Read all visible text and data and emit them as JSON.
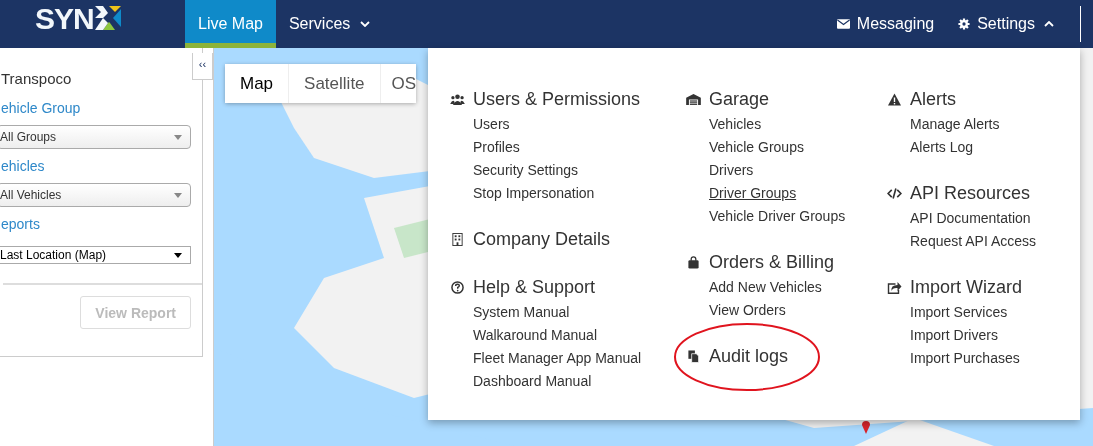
{
  "logo": {
    "text": "SYN"
  },
  "nav": [
    {
      "label": "Live Map",
      "selected": true,
      "kind": "tab"
    },
    {
      "label": "Services",
      "selected": false,
      "kind": "dropdown",
      "expanded": false
    }
  ],
  "nav_right": [
    {
      "label": "Messaging",
      "kind": "link"
    },
    {
      "label": "Settings",
      "expanded": true,
      "kind": "dropdown"
    }
  ],
  "sidebar": {
    "collapse": "‹‹",
    "company": "Transpoco",
    "fields": [
      {
        "label": "ehicle Group",
        "value": "All Groups",
        "kind": "styled"
      },
      {
        "label": "ehicles",
        "value": "All Vehicles",
        "kind": "styled"
      },
      {
        "label": "eports",
        "value": "Last Location (Map)",
        "kind": "native"
      }
    ],
    "button": {
      "label": "View Report",
      "disabled": true
    }
  },
  "map": {
    "kind": "picture",
    "map_types": [
      {
        "label": "Map",
        "selected": true
      },
      {
        "label": "Satellite",
        "selected": false
      },
      {
        "label": "OS",
        "selected": false
      }
    ]
  },
  "settings_menu": {
    "columns": [
      [
        {
          "title": "Users & Permissions",
          "items": [
            {
              "label": "Users",
              "hovered": false
            },
            {
              "label": "Profiles",
              "hovered": false
            },
            {
              "label": "Security Settings",
              "hovered": false
            },
            {
              "label": "Stop Impersonation",
              "hovered": false
            }
          ]
        },
        {
          "title": "Company Details"
        },
        {
          "title": "Help & Support",
          "items": [
            {
              "label": "System Manual",
              "hovered": false
            },
            {
              "label": "Walkaround Manual",
              "hovered": false
            },
            {
              "label": "Fleet Manager App Manual",
              "hovered": false
            },
            {
              "label": "Dashboard Manual",
              "hovered": false
            }
          ]
        }
      ],
      [
        {
          "title": "Garage",
          "items": [
            {
              "label": "Vehicles",
              "hovered": false
            },
            {
              "label": "Vehicle Groups",
              "hovered": false
            },
            {
              "label": "Drivers",
              "hovered": false
            },
            {
              "label": "Driver Groups",
              "hovered": true
            },
            {
              "label": "Vehicle Driver Groups",
              "hovered": false
            }
          ]
        },
        {
          "title": "Orders & Billing",
          "items": [
            {
              "label": "Add New Vehicles",
              "hovered": false
            },
            {
              "label": "View Orders",
              "hovered": false
            }
          ]
        },
        {
          "title": "Audit logs",
          "circled": true
        }
      ],
      [
        {
          "title": "Alerts",
          "items": [
            {
              "label": "Manage Alerts",
              "hovered": false
            },
            {
              "label": "Alerts Log",
              "hovered": false
            }
          ]
        },
        {
          "title": "API Resources",
          "items": [
            {
              "label": "API Documentation",
              "hovered": false
            },
            {
              "label": "Request API Access",
              "hovered": false
            }
          ]
        },
        {
          "title": "Import Wizard",
          "items": [
            {
              "label": "Import Services",
              "hovered": false
            },
            {
              "label": "Import Drivers",
              "hovered": false
            },
            {
              "label": "Import Purchases",
              "hovered": false
            }
          ]
        }
      ]
    ]
  }
}
